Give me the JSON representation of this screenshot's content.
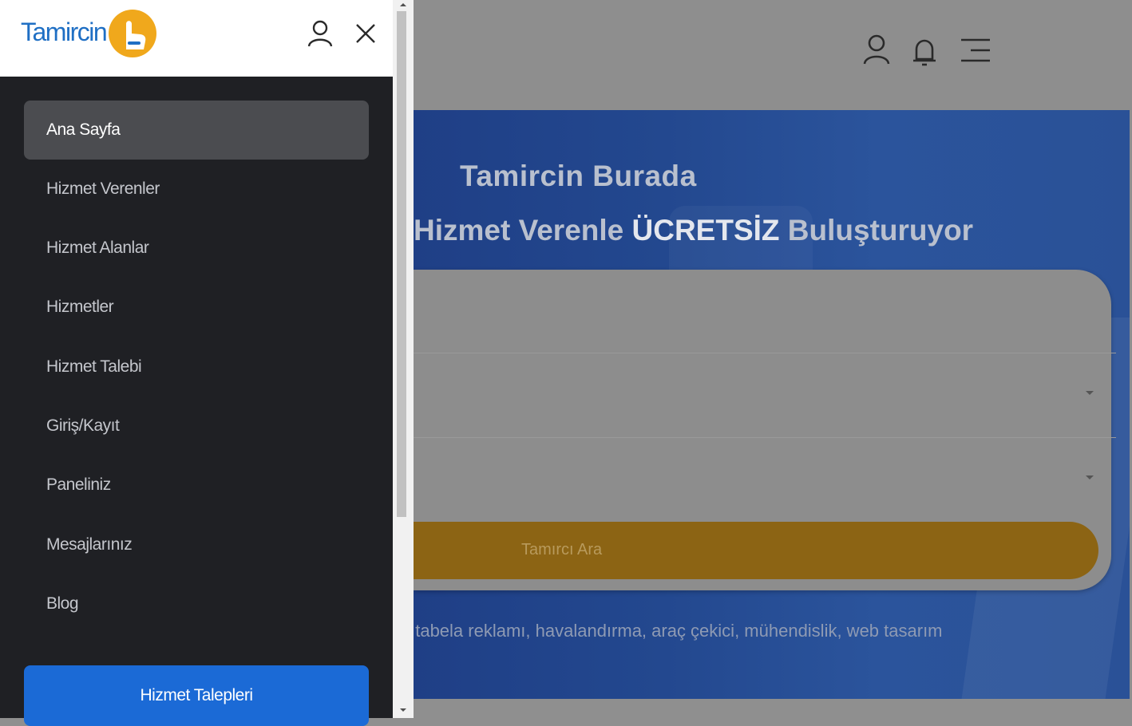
{
  "drawer": {
    "logo_text": "Tamircin",
    "nav_items": [
      {
        "label": "Ana Sayfa",
        "active": true
      },
      {
        "label": "Hizmet Verenler"
      },
      {
        "label": "Hizmet Alanlar"
      },
      {
        "label": "Hizmetler"
      },
      {
        "label": "Hizmet Talebi"
      },
      {
        "label": "Giriş/Kayıt"
      },
      {
        "label": "Paneliniz"
      },
      {
        "label": "Mesajlarınız"
      },
      {
        "label": "Blog"
      }
    ],
    "cta_label": "Hizmet Talepleri"
  },
  "hero": {
    "title": "Tamircin Burada",
    "subtitle_pre": "Hizmet Verenle ",
    "subtitle_em": "ÜCRETSİZ",
    "subtitle_post": " Buluşturuyor",
    "search_button_label": "Tamırcı Ara",
    "tags_line": ", tabela reklamı, havalandırma, araç çekici, mühendislik, web tasarım"
  },
  "icons": {
    "drawer_user": "user-icon",
    "drawer_close": "close-icon",
    "header_user": "user-icon",
    "header_bell": "bell-icon",
    "header_menu": "menu-icon"
  },
  "colors": {
    "drawer_bg": "#1f2024",
    "active_item_bg": "#4b4c50",
    "cta_blue": "#1b6ad6",
    "logo_blue": "#1f6fc4",
    "logo_orange": "#f0a81c",
    "hero_blue": "#23488f",
    "search_button": "#8c6414"
  }
}
